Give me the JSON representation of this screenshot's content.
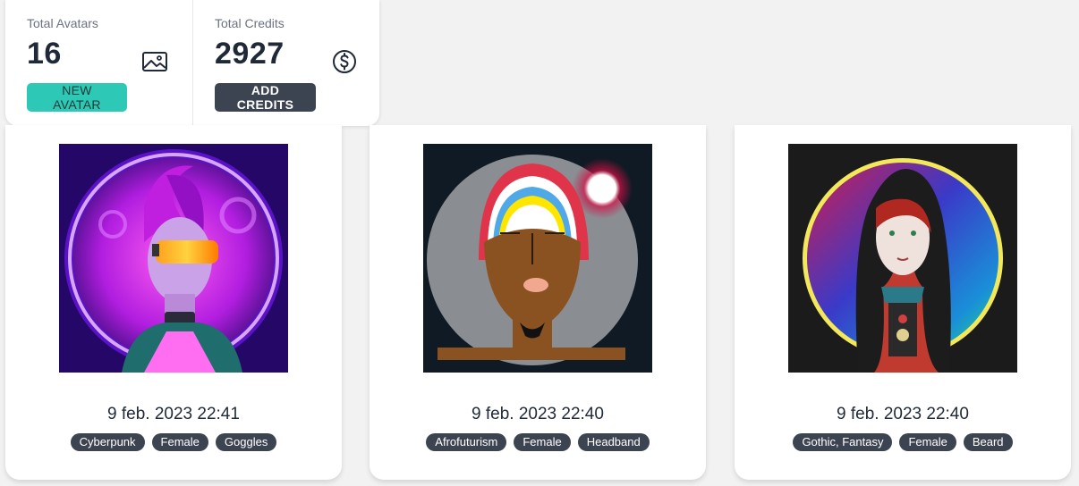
{
  "stats": {
    "avatars": {
      "title": "Total Avatars",
      "value": "16",
      "button": "NEW AVATAR",
      "icon": "image-icon"
    },
    "credits": {
      "title": "Total Credits",
      "value": "2927",
      "button": "ADD CREDITS",
      "icon": "dollar-icon"
    }
  },
  "avatars": [
    {
      "date": "9 feb. 2023 22:41",
      "tags": [
        "Cyberpunk",
        "Female",
        "Goggles"
      ],
      "image": "cyberpunk-avatar-image"
    },
    {
      "date": "9 feb. 2023 22:40",
      "tags": [
        "Afrofuturism",
        "Female",
        "Headband"
      ],
      "image": "afrofuturism-avatar-image"
    },
    {
      "date": "9 feb. 2023 22:40",
      "tags": [
        "Gothic, Fantasy",
        "Female",
        "Beard"
      ],
      "image": "gothic-avatar-image"
    }
  ],
  "colors": {
    "accent": "#2ec9b6",
    "dark": "#3d4451",
    "background": "#f2f2f2"
  }
}
